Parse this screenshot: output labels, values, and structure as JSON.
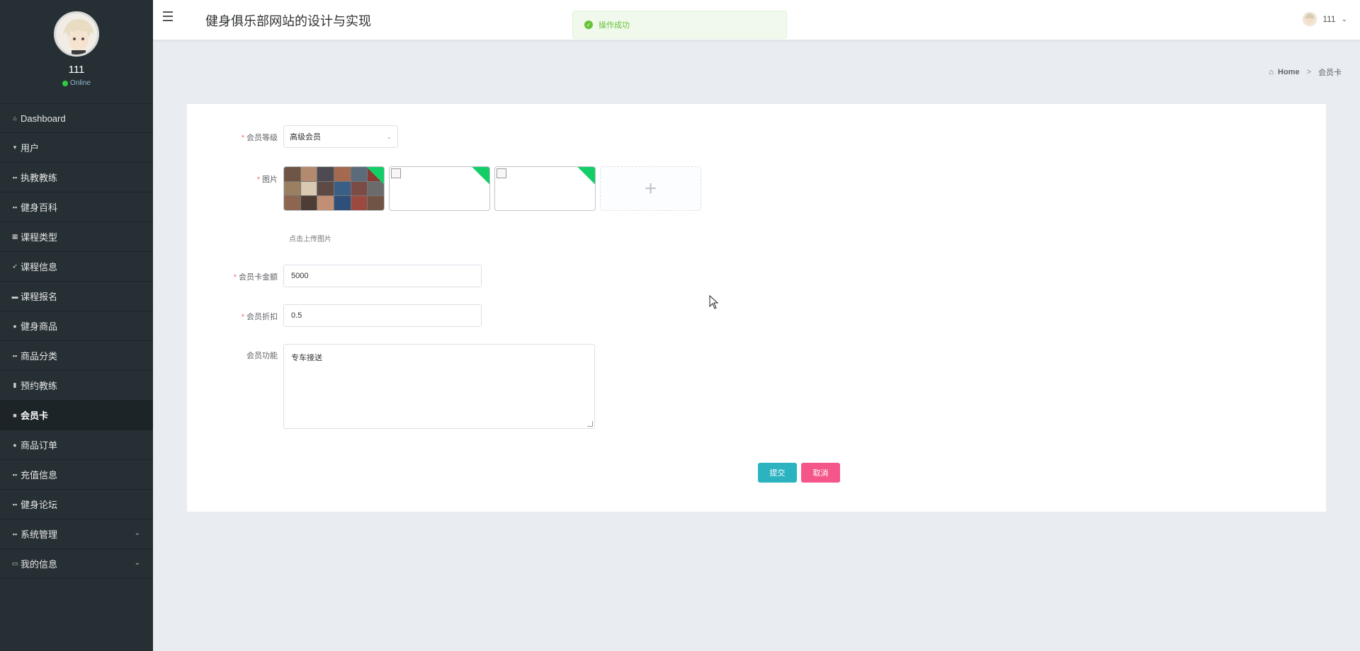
{
  "sidebar": {
    "username": "111",
    "status": "Online",
    "items": [
      {
        "label": "Dashboard",
        "icon": "home-icon"
      },
      {
        "label": "用户",
        "icon": "pin-icon"
      },
      {
        "label": "执教教练",
        "icon": "grid-icon"
      },
      {
        "label": "健身百科",
        "icon": "grid-icon"
      },
      {
        "label": "课程类型",
        "icon": "grid-icon"
      },
      {
        "label": "课程信息",
        "icon": "send-icon"
      },
      {
        "label": "课程报名",
        "icon": "briefcase-icon"
      },
      {
        "label": "健身商品",
        "icon": "user-icon"
      },
      {
        "label": "商品分类",
        "icon": "grid-icon"
      },
      {
        "label": "预约教练",
        "icon": "chart-icon"
      },
      {
        "label": "会员卡",
        "icon": "clipboard-icon"
      },
      {
        "label": "商品订单",
        "icon": "location-icon"
      },
      {
        "label": "充值信息",
        "icon": "grid-icon"
      },
      {
        "label": "健身论坛",
        "icon": "grid-icon"
      },
      {
        "label": "系统管理",
        "icon": "grid-icon"
      },
      {
        "label": "我的信息",
        "icon": "card-icon"
      }
    ]
  },
  "header": {
    "title": "健身俱乐部网站的设计与实现",
    "user": "111"
  },
  "toast": {
    "message": "操作成功"
  },
  "breadcrumb": {
    "home": "Home",
    "current": "会员卡"
  },
  "form": {
    "level_label": "会员等级",
    "level_value": "高级会员",
    "image_label": "图片",
    "upload_tip": "点击上传图片",
    "amount_label": "会员卡金额",
    "amount_value": "5000",
    "discount_label": "会员折扣",
    "discount_value": "0.5",
    "features_label": "会员功能",
    "features_value": "专车接送",
    "submit_label": "提交",
    "cancel_label": "取消"
  },
  "colors": {
    "sidebar_bg": "#263034",
    "submit": "#2bb3c0",
    "cancel": "#f4568a",
    "success": "#67c23a"
  }
}
